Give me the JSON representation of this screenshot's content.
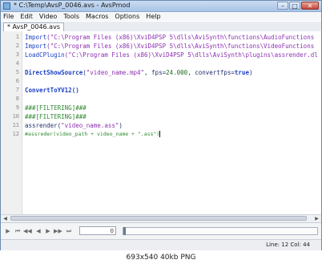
{
  "window": {
    "title": "* C:\\Temp\\AvsP_0046.avs - AvsPmod",
    "minimize": "–",
    "maximize": "□",
    "close": "✕"
  },
  "menu": [
    "File",
    "Edit",
    "Video",
    "Tools",
    "Macros",
    "Options",
    "Help"
  ],
  "tab": {
    "label": "* AvsP_0046.avs"
  },
  "editor": {
    "line_numbers": [
      "1",
      "2",
      "3",
      "4",
      "5",
      "6",
      "7",
      "8",
      "9",
      "10",
      "11",
      "12"
    ],
    "lines": {
      "l1_fn": "Import",
      "l1_str": "(\"C:\\Program Files (x86)\\XviD4PSP 5\\dlls\\AviSynth\\functions\\AudioFunctions",
      "l2_fn": "Import",
      "l2_str": "(\"C:\\Program Files (x86)\\XviD4PSP 5\\dlls\\AviSynth\\functions\\VideoFunctions",
      "l3_fn": "LoadCPlugin",
      "l3_str": "(\"C:\\Program Files (x86)\\XviD4PSP 5\\dlls\\AviSynth\\plugins\\assrender.dl",
      "l5_fn": "DirectShowSource",
      "l5_a": "(",
      "l5_str": "\"video_name.mp4\"",
      "l5_b": ", fps=",
      "l5_num": "24.000",
      "l5_c": ", convertfps=",
      "l5_kw": "true",
      "l5_d": ")",
      "l7_fn": "ConvertToYV12()",
      "l9": "###[FILTERING]###",
      "l10": "###[FILTERING]###",
      "l11_a": "assrender(",
      "l11_str": "\"video_name.ass\"",
      "l11_b": ")",
      "l12": "#assreder(video_path + video_name + \".ass\")"
    }
  },
  "player": {
    "frame_value": "0"
  },
  "status": {
    "text": "Line: 12  Col: 44"
  },
  "caption": "693x540 40kb PNG"
}
